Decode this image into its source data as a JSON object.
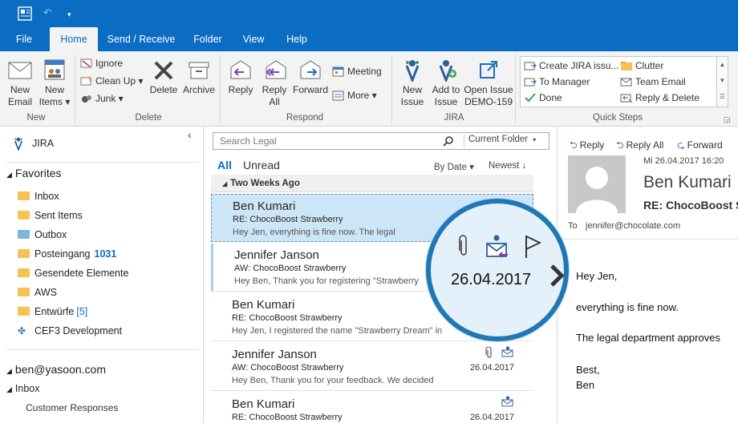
{
  "tabs": [
    "File",
    "Home",
    "Send / Receive",
    "Folder",
    "View",
    "Help"
  ],
  "ribbon": {
    "new_email": [
      "New",
      "Email"
    ],
    "new_items": [
      "New",
      "Items ▾"
    ],
    "ignore": "Ignore",
    "clean_up": "Clean Up ▾",
    "junk": "Junk ▾",
    "delete": "Delete",
    "archive": "Archive",
    "reply": "Reply",
    "reply_all": [
      "Reply",
      "All"
    ],
    "forward": "Forward",
    "meeting": "Meeting",
    "more": "More ▾",
    "new_issue": [
      "New",
      "Issue"
    ],
    "add_to_issue": [
      "Add to",
      "Issue"
    ],
    "open_issue": [
      "Open Issue",
      "DEMO-159"
    ],
    "quick_steps": [
      {
        "label": "Create JIRA issu...",
        "icon": "envelope-arrow-icon"
      },
      {
        "label": "To Manager",
        "icon": "envelope-arrow-icon"
      },
      {
        "label": "Done",
        "icon": "checkmark-icon"
      },
      {
        "label": "Clutter",
        "icon": "folder-icon"
      },
      {
        "label": "Team Email",
        "icon": "envelope-icon"
      },
      {
        "label": "Reply & Delete",
        "icon": "reply-delete-icon"
      }
    ],
    "groups": [
      "New",
      "Delete",
      "Respond",
      "JIRA",
      "Quick Steps"
    ]
  },
  "nav": {
    "jira_label": "JIRA",
    "favorites": "Favorites",
    "folders": [
      {
        "name": "Inbox",
        "count": ""
      },
      {
        "name": "Sent Items",
        "count": ""
      },
      {
        "name": "Outbox",
        "count": ""
      },
      {
        "name": "Posteingang",
        "count": "1031"
      },
      {
        "name": "Gesendete Elemente",
        "count": ""
      },
      {
        "name": "AWS",
        "count": ""
      },
      {
        "name": "Entwürfe",
        "count": "[5]"
      },
      {
        "name": "CEF3 Development",
        "count": ""
      }
    ],
    "account": "ben@yasoon.com",
    "inbox": "Inbox",
    "customer_responses": "Customer Responses"
  },
  "list": {
    "search_placeholder": "Search Legal",
    "scope": "Current Folder",
    "filter_all": "All",
    "filter_unread": "Unread",
    "sort_by": "By Date ▾",
    "sort_order": "Newest ↓",
    "group_header": "Two Weeks Ago",
    "messages": [
      {
        "from": "Ben Kumari",
        "subject": "RE: ChocoBoost Strawberry",
        "preview": "Hey Jen,    everything is fine now.   The legal",
        "date": ""
      },
      {
        "from": "Jennifer Janson",
        "subject": "AW: ChocoBoost Strawberry",
        "preview": "Hey Ben,   Thank you for registering \"Strawberry",
        "date": ""
      },
      {
        "from": "Ben Kumari",
        "subject": "RE: ChocoBoost Strawberry",
        "preview": "Hey Jen,    I registered the name \"Strawberry Dream\" in",
        "date": ""
      },
      {
        "from": "Jennifer Janson",
        "subject": "AW: ChocoBoost Strawberry",
        "preview": "Hey Ben,   Thank you for your feedback. We decided",
        "date": "26.04.2017"
      },
      {
        "from": "Ben Kumari",
        "subject": "RE: ChocoBoost Strawberry",
        "preview": "",
        "date": "26.04.2017"
      }
    ]
  },
  "magnifier": {
    "date": "26.04.2017"
  },
  "reading": {
    "reply": "Reply",
    "reply_all": "Reply All",
    "forward": "Forward",
    "timestamp": "Mi 26.04.2017 16:20",
    "sender": "Ben Kumari",
    "subject": "RE: ChocoBoost S",
    "to_label": "To",
    "to_value": "jennifer@chocolate.com",
    "body": [
      "Hey Jen,",
      "everything is fine now.",
      "The legal department approves",
      "Best,",
      "Ben"
    ]
  },
  "colors": {
    "accent": "#0b6cc4",
    "selected_row": "#cde6f7",
    "magnifier_ring": "#1f78b4"
  }
}
